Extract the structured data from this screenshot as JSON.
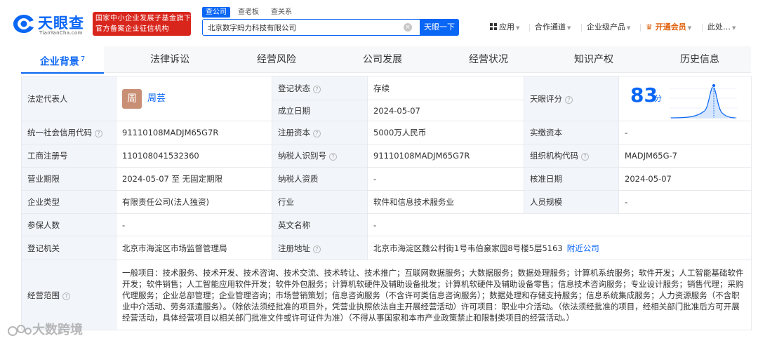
{
  "header": {
    "logo_cn": "天眼查",
    "logo_en": "TianYanCha.com",
    "gov_badge_line1": "国家中小企业发展子基金旗下",
    "gov_badge_line2": "官方备案企业征信机构",
    "search_tabs": [
      "查公司",
      "查老板",
      "查关系"
    ],
    "search_value": "北京数字蚂力科技有限公司",
    "search_button": "天眼一下",
    "nav": {
      "app": "应用",
      "cooperation": "合作通道",
      "enterprise": "企业级产品",
      "vip": "开通会员",
      "more": "此处…"
    }
  },
  "tabs": [
    {
      "label": "企业背景",
      "count": "7"
    },
    {
      "label": "法律诉讼"
    },
    {
      "label": "经营风险"
    },
    {
      "label": "公司发展"
    },
    {
      "label": "经营状况"
    },
    {
      "label": "知识产权"
    },
    {
      "label": "历史信息"
    }
  ],
  "info": {
    "legal_rep_label": "法定代表人",
    "legal_rep_avatar": "周",
    "legal_rep_name": "周芸",
    "reg_status_label": "登记状态",
    "reg_status": "存续",
    "found_date_label": "成立日期",
    "found_date": "2024-05-07",
    "rating_label": "天眼评分",
    "rating_score": "83",
    "rating_unit": "分",
    "credit_code_label": "统一社会信用代码",
    "credit_code": "91110108MADJM65G7R",
    "reg_capital_label": "注册资本",
    "reg_capital": "5000万人民币",
    "paid_capital_label": "实缴资本",
    "paid_capital": "-",
    "biz_reg_no_label": "工商注册号",
    "biz_reg_no": "110108041532360",
    "tax_id_label": "纳税人识别号",
    "tax_id": "91110108MADJM65G7R",
    "org_code_label": "组织机构代码",
    "org_code": "MADJM65G-7",
    "term_label": "营业期限",
    "term": "2024-05-07 至 无固定期限",
    "taxpayer_qual_label": "纳税人资质",
    "taxpayer_qual": "-",
    "approval_date_label": "核准日期",
    "approval_date": "2024-05-07",
    "company_type_label": "企业类型",
    "company_type": "有限责任公司(法人独资)",
    "industry_label": "行业",
    "industry": "软件和信息技术服务业",
    "staff_size_label": "人员规模",
    "staff_size": "-",
    "insured_label": "参保人数",
    "insured": "-",
    "english_name_label": "英文名称",
    "english_name": "-",
    "reg_authority_label": "登记机关",
    "reg_authority": "北京市海淀区市场监督管理局",
    "reg_address_label": "注册地址",
    "reg_address": "北京市海淀区魏公村街1号韦伯豪家园8号楼5层5163",
    "nearby_link": "附近公司",
    "scope_label": "经营范围",
    "scope": "一般项目：技术服务、技术开发、技术咨询、技术交流、技术转让、技术推广；互联网数据服务；大数据服务；数据处理服务；计算机系统服务；软件开发；人工智能基础软件开发；软件销售；人工智能应用软件开发；软件外包服务；计算机软硬件及辅助设备批发；计算机软硬件及辅助设备零售；信息技术咨询服务；专业设计服务；销售代理；采购代理服务；企业总部管理；企业管理咨询；市场营销策划；信息咨询服务（不含许可类信息咨询服务）；数据处理和存储支持服务；信息系统集成服务；人力资源服务（不含职业中介活动、劳务派遣服务）。（除依法须经批准的项目外，凭营业执照依法自主开展经营活动）许可项目：职业中介活动。（依法须经批准的项目，经相关部门批准后方可开展经营活动，具体经营项目以相关部门批准文件或许可证件为准）（不得从事国家和本市产业政策禁止和限制类项目的经营活动。）"
  },
  "watermark": "大数跨境",
  "colors": {
    "brand_blue": "#0a66f5",
    "badge_red": "#d9261c",
    "status_green": "#1aa354",
    "vip_orange": "#e0600d"
  }
}
